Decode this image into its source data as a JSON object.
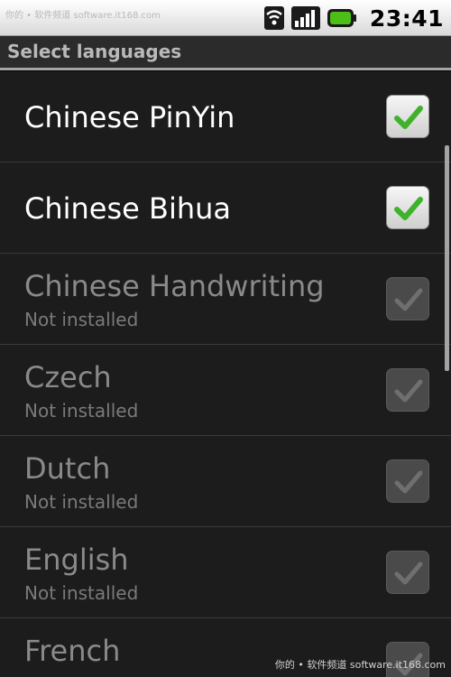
{
  "status_bar": {
    "time": "23:41",
    "watermark": "你的 • 软件频道 software.it168.com",
    "icons": [
      "wifi-icon",
      "signal-icon",
      "battery-icon"
    ],
    "battery_color": "#4bbf16"
  },
  "title": "Select languages",
  "items": [
    {
      "label": "Chinese PinYin",
      "sub": "",
      "checked": true,
      "enabled": true
    },
    {
      "label": "Chinese Bihua",
      "sub": "",
      "checked": true,
      "enabled": true
    },
    {
      "label": "Chinese Handwriting",
      "sub": "Not installed",
      "checked": false,
      "enabled": false
    },
    {
      "label": "Czech",
      "sub": "Not installed",
      "checked": false,
      "enabled": false
    },
    {
      "label": "Dutch",
      "sub": "Not installed",
      "checked": false,
      "enabled": false
    },
    {
      "label": "English",
      "sub": "Not installed",
      "checked": false,
      "enabled": false
    },
    {
      "label": "French",
      "sub": "",
      "checked": false,
      "enabled": false
    }
  ],
  "watermark_bottom": "你的 • 软件频道 software.it168.com",
  "colors": {
    "check_green": "#3db22a",
    "check_gray": "#6f6f6f"
  }
}
